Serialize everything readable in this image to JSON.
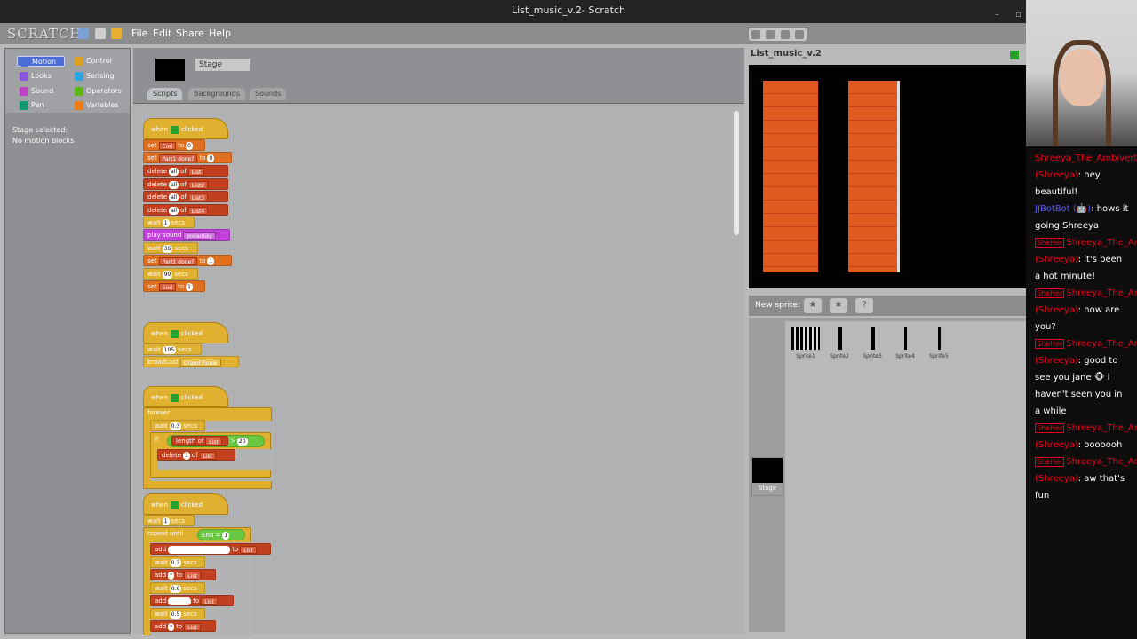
{
  "window": {
    "title": "List_music_v.2- Scratch"
  },
  "menubar": {
    "logo": "SCRATCH",
    "items": [
      "File",
      "Edit",
      "Share",
      "Help"
    ]
  },
  "categories": [
    {
      "label": "Motion",
      "color": "#4a6cd4"
    },
    {
      "label": "Control",
      "color": "#e0a020"
    },
    {
      "label": "Looks",
      "color": "#8a55d7"
    },
    {
      "label": "Sensing",
      "color": "#2ca5e2"
    },
    {
      "label": "Sound",
      "color": "#bb42c3"
    },
    {
      "label": "Operators",
      "color": "#5cb712"
    },
    {
      "label": "Pen",
      "color": "#0e9a6c"
    },
    {
      "label": "Variables",
      "color": "#ee7d16"
    }
  ],
  "palette": {
    "line1": "Stage selected:",
    "line2": "No motion blocks"
  },
  "sprite_header": {
    "name": "Stage"
  },
  "tabs": [
    "Scripts",
    "Backgrounds",
    "Sounds"
  ],
  "scripts": {
    "s1": {
      "hat": "when",
      "hat2": "clicked",
      "b1": {
        "a": "set",
        "v": "End",
        "b": "to",
        "n": "0"
      },
      "b2": {
        "a": "set",
        "v": "Part1 done?",
        "b": "to",
        "n": "0"
      },
      "b3": {
        "a": "delete",
        "n": "all",
        "b": "of",
        "l": "List"
      },
      "b4": {
        "a": "delete",
        "n": "all",
        "b": "of",
        "l": "List2"
      },
      "b5": {
        "a": "delete",
        "n": "all",
        "b": "of",
        "l": "List3"
      },
      "b6": {
        "a": "delete",
        "n": "all",
        "b": "of",
        "l": "List4"
      },
      "b7": {
        "a": "wait",
        "n": "1",
        "b": "secs"
      },
      "b8": {
        "a": "play sound",
        "s": "JovianSky"
      },
      "b9": {
        "a": "wait",
        "n": "36",
        "b": "secs"
      },
      "b10": {
        "a": "set",
        "v": "Part1 done?",
        "b": "to",
        "n": "1"
      },
      "b11": {
        "a": "wait",
        "n": "90",
        "b": "secs"
      },
      "b12": {
        "a": "set",
        "v": "End",
        "b": "to",
        "n": "1"
      }
    },
    "s2": {
      "hat": "when",
      "hat2": "clicked",
      "b1": {
        "a": "wait",
        "n": "105",
        "b": "secs"
      },
      "b2": {
        "a": "broadcast",
        "s": "Grand Finale"
      }
    },
    "s3": {
      "hat": "when",
      "hat2": "clicked",
      "forever": "forever",
      "b1": {
        "a": "wait",
        "n": "0.3",
        "b": "secs"
      },
      "if": {
        "a": "if",
        "op": "length of",
        "l": "List",
        "cmp": ">",
        "n": "20"
      },
      "b2": {
        "a": "delete",
        "n": "1",
        "b": "of",
        "l": "List"
      }
    },
    "s4": {
      "hat": "when",
      "hat2": "clicked",
      "b1": {
        "a": "wait",
        "n": "1",
        "b": "secs"
      },
      "b2": {
        "a": "repeat until",
        "v": "End",
        "cmp": "=",
        "n": "1"
      },
      "b3": {
        "a": "add",
        "b": "to",
        "l": "List"
      },
      "b4": {
        "a": "wait",
        "n": "0.3",
        "b": "secs"
      },
      "b5": {
        "a": "add",
        "n": "*",
        "b": "to",
        "l": "List"
      },
      "b6": {
        "a": "wait",
        "n": "0.6",
        "b": "secs"
      },
      "b7": {
        "a": "add",
        "b": "to",
        "l": "List"
      },
      "b8": {
        "a": "wait",
        "n": "0.5",
        "b": "secs"
      },
      "b9": {
        "a": "add",
        "n": "*",
        "b": "to",
        "l": "List"
      }
    }
  },
  "stage": {
    "title": "List_music_v.2"
  },
  "new_sprite": {
    "label": "New sprite:"
  },
  "sprites": [
    "Sprite1",
    "Sprite2",
    "Sprite3",
    "Sprite4",
    "Sprite5"
  ],
  "stage_icon": {
    "label": "Stage"
  },
  "chat": [
    {
      "user": "Shreeya_The_Ambivert (Shreeya)",
      "text": ": hey beautiful!",
      "bot": false,
      "badge": ""
    },
    {
      "user": "JJBotBot (🤖)",
      "text": ": hows it going Shreeya",
      "bot": true,
      "badge": ""
    },
    {
      "user": "Shreeya_The_Ambivert (Shreeya)",
      "text": ": it's been a hot minute!",
      "bot": false,
      "badge": "SheHer"
    },
    {
      "user": "Shreeya_The_Ambivert (Shreeya)",
      "text": ": how are you?",
      "bot": false,
      "badge": "SheHer"
    },
    {
      "user": "Shreeya_The_Ambivert (Shreeya)",
      "text": ": good to see you jane 🐵 i haven't seen you in a while",
      "bot": false,
      "badge": "SheHer"
    },
    {
      "user": "Shreeya_The_Ambivert (Shreeya)",
      "text": ": ooooooh",
      "bot": false,
      "badge": "SheHer"
    },
    {
      "user": "Shreeya_The_Ambivert (Shreeya)",
      "text": ": aw that's fun",
      "bot": false,
      "badge": "SheHer"
    }
  ]
}
